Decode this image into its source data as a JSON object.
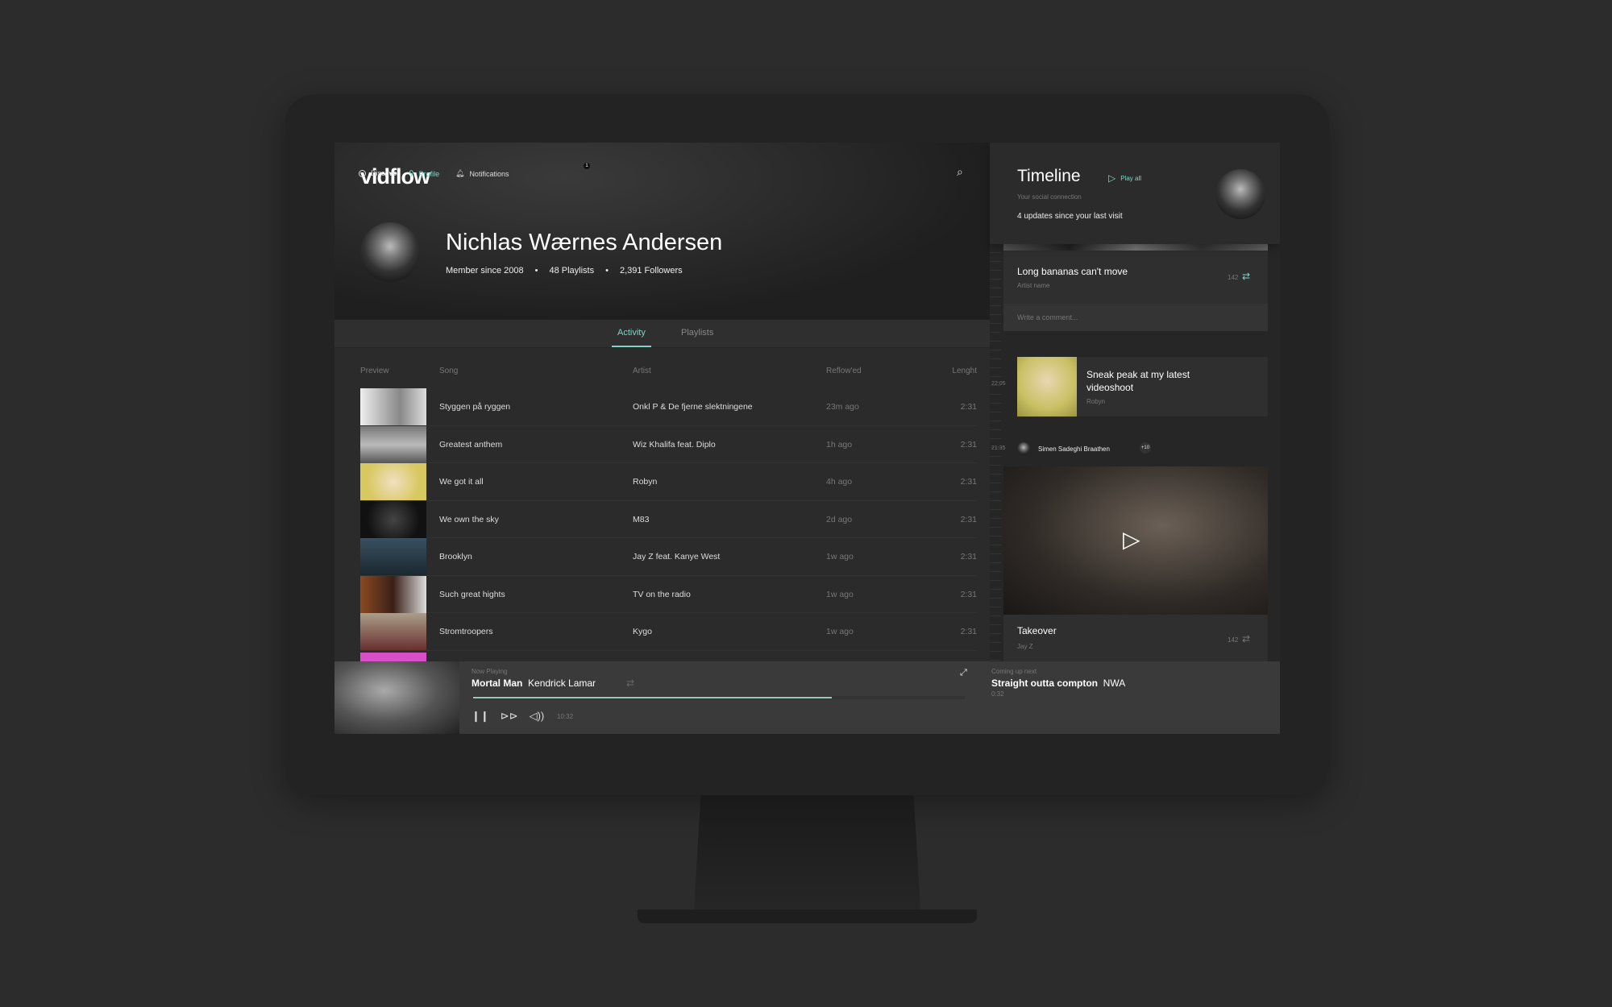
{
  "nav": {
    "logo": "vidflow",
    "items": [
      {
        "label": "Discover",
        "icon": "circle-icon"
      },
      {
        "label": "Profile",
        "icon": "user-icon",
        "active": true
      },
      {
        "label": "Notifications",
        "icon": "bell-icon",
        "badge": "1"
      }
    ]
  },
  "profile": {
    "name": "Nichlas Wærnes Andersen",
    "member_since": "Member since 2008",
    "playlists": "48 Playlists",
    "followers": "2,391 Followers"
  },
  "tabs": [
    {
      "label": "Activity",
      "active": true
    },
    {
      "label": "Playlists"
    }
  ],
  "table": {
    "headers": [
      "Preview",
      "Song",
      "Artist",
      "Reflow'ed",
      "Lenght"
    ],
    "rows": [
      {
        "song": "Styggen på ryggen",
        "artist": "Onkl P & De fjerne slektningene",
        "reflowed": "23m ago",
        "length": "2:31"
      },
      {
        "song": "Greatest anthem",
        "artist": "Wiz Khalifa feat. Diplo",
        "reflowed": "1h ago",
        "length": "2:31"
      },
      {
        "song": "We got it all",
        "artist": "Robyn",
        "reflowed": "4h ago",
        "length": "2:31"
      },
      {
        "song": "We own the sky",
        "artist": "M83",
        "reflowed": "2d ago",
        "length": "2:31"
      },
      {
        "song": "Brooklyn",
        "artist": "Jay Z feat. Kanye West",
        "reflowed": "1w ago",
        "length": "2:31"
      },
      {
        "song": "Such great hights",
        "artist": "TV on the radio",
        "reflowed": "1w ago",
        "length": "2:31"
      },
      {
        "song": "Stromtroopers",
        "artist": "Kygo",
        "reflowed": "1w ago",
        "length": "2:31"
      }
    ]
  },
  "timeline": {
    "title": "Timeline",
    "play_all": "Play all",
    "subtitle": "Your social connection",
    "updates": "4 updates since your last visit",
    "card1": {
      "title": "Long bananas can't move",
      "artist": "Artist name",
      "count": "142",
      "comment_placeholder": "Write a comment..."
    },
    "card2": {
      "time": "22:05",
      "title": "Sneak peak at my latest videoshoot",
      "artist": "Robyn"
    },
    "card3": {
      "time": "21:35",
      "user": "Simen Sadeghi Braathen",
      "extra": "+10",
      "title": "Takeover",
      "artist": "Jay Z",
      "count": "142"
    }
  },
  "player": {
    "label": "Now Playing",
    "title": "Mortal Man",
    "artist": "Kendrick Lamar",
    "time": "10:32",
    "progress": 0.73,
    "next_label": "Coming up next",
    "next_title": "Straight outta compton",
    "next_artist": "NWA",
    "next_time": "0:32"
  },
  "colors": {
    "accent": "#7fd6c4"
  }
}
